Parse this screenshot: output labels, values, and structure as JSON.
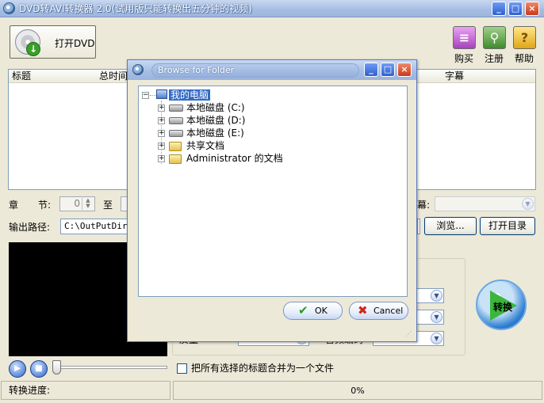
{
  "window": {
    "title": "DVD转AVI转换器 2.0(试用版只能转换出五分钟的视频)",
    "minimize": "_",
    "maximize": "□",
    "close": "×"
  },
  "toolbar": {
    "open_dvd": "打开DVD",
    "buy": "购买",
    "register": "注册",
    "help": "帮助",
    "help_glyph": "?"
  },
  "title_list": {
    "columns": [
      "标题",
      "总时间",
      "字幕"
    ]
  },
  "chapter": {
    "label": "章",
    "section_label": "节:",
    "from_value": "0",
    "to_label": "至",
    "right_label": "幕:"
  },
  "output": {
    "label": "输出路径:",
    "path": "C:\\OutPutDir",
    "browse": "浏览...",
    "open_dir": "打开目录"
  },
  "panel": {
    "row3_left_label": "质量",
    "row3_right_label": "音频编码"
  },
  "convert": {
    "label": "转换"
  },
  "merge": {
    "label": "把所有选择的标题合并为一个文件"
  },
  "status": {
    "progress_label": "转换进度:",
    "percent": "0%",
    "progress": 0
  },
  "dialog": {
    "title": "Browse for Folder",
    "tree": [
      {
        "label": "我的电脑",
        "icon": "computer-icon",
        "selected": true
      },
      {
        "label": "本地磁盘 (C:)",
        "icon": "drive-icon"
      },
      {
        "label": "本地磁盘 (D:)",
        "icon": "drive-icon"
      },
      {
        "label": "本地磁盘 (E:)",
        "icon": "drive-icon"
      },
      {
        "label": "共享文档",
        "icon": "folder-icon"
      },
      {
        "label": "Administrator 的文档",
        "icon": "folder-icon"
      }
    ],
    "ok": "OK",
    "cancel": "Cancel"
  },
  "colors": {
    "titlebar": "#a6bde3",
    "selection": "#316ac5",
    "face": "#ece9d8"
  }
}
